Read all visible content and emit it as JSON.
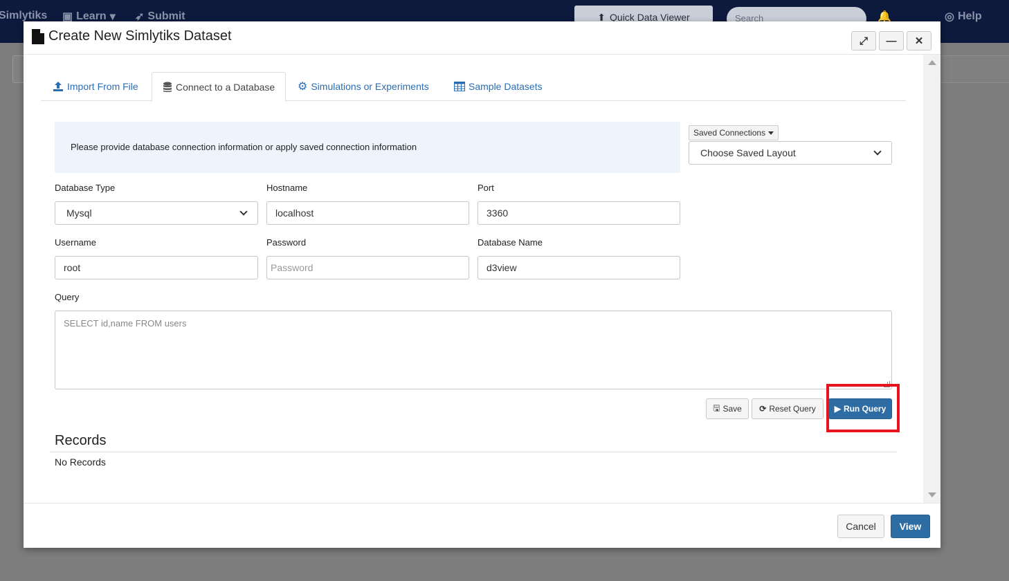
{
  "background": {
    "nav_items": [
      {
        "label": "Simlytiks"
      },
      {
        "label": "Learn"
      },
      {
        "label": "Submit"
      }
    ],
    "quick_data_viewer": "Quick Data Viewer",
    "search_placeholder": "Search",
    "help": "Help"
  },
  "modal": {
    "title": "Create New Simlytiks Dataset",
    "tabs": [
      {
        "label": "Import From File",
        "icon": "upload-icon"
      },
      {
        "label": "Connect to a Database",
        "icon": "database-icon"
      },
      {
        "label": "Simulations or Experiments",
        "icon": "gear-icon"
      },
      {
        "label": "Sample Datasets",
        "icon": "table-icon"
      }
    ],
    "active_tab": "Connect to a Database",
    "info_text": "Please provide database connection information or apply saved connection information",
    "saved_connections_label": "Saved Connections",
    "saved_layout_select": "Choose Saved Layout",
    "fields": {
      "db_type_label": "Database Type",
      "db_type_value": "Mysql",
      "hostname_label": "Hostname",
      "hostname_value": "localhost",
      "port_label": "Port",
      "port_value": "3360",
      "username_label": "Username",
      "username_value": "root",
      "password_label": "Password",
      "password_placeholder": "Password",
      "dbname_label": "Database Name",
      "dbname_value": "d3view",
      "query_label": "Query",
      "query_placeholder": "SELECT id,name FROM users"
    },
    "buttons": {
      "save": "Save",
      "reset_query": "Reset Query",
      "run_query": "Run Query"
    },
    "records_title": "Records",
    "records_empty": "No Records",
    "footer": {
      "cancel": "Cancel",
      "view": "View"
    }
  },
  "colors": {
    "nav_bg": "#0d1a3d",
    "primary": "#2e6da4",
    "link": "#2a6db3",
    "info_bg": "#edf4fc",
    "highlight": "#e8141d"
  }
}
